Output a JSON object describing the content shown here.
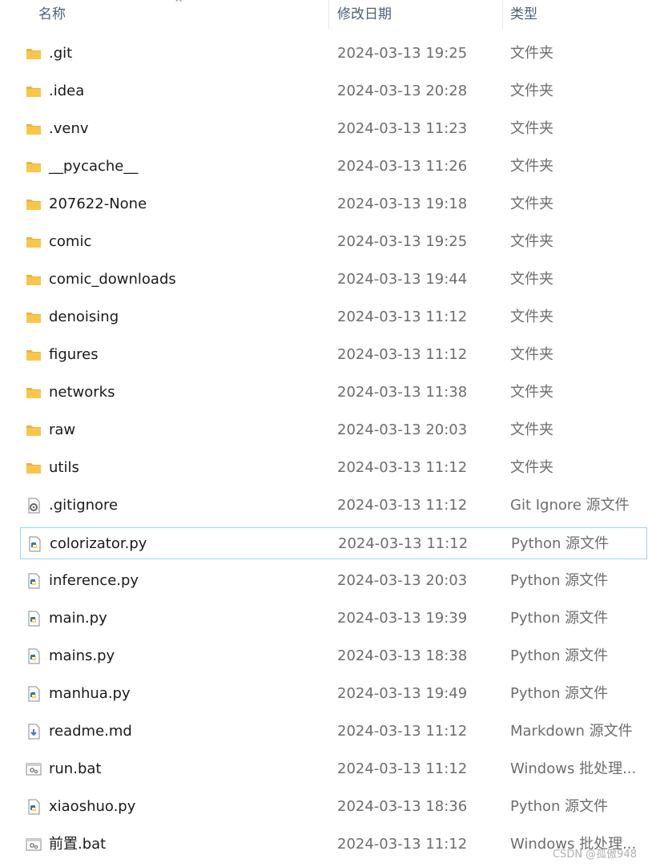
{
  "columns": {
    "name": "名称",
    "date": "修改日期",
    "type": "类型"
  },
  "files": [
    {
      "name": ".git",
      "date": "2024-03-13 19:25",
      "type": "文件夹",
      "icon": "folder-icon"
    },
    {
      "name": ".idea",
      "date": "2024-03-13 20:28",
      "type": "文件夹",
      "icon": "folder-icon"
    },
    {
      "name": ".venv",
      "date": "2024-03-13 11:23",
      "type": "文件夹",
      "icon": "folder-icon"
    },
    {
      "name": "__pycache__",
      "date": "2024-03-13 11:26",
      "type": "文件夹",
      "icon": "folder-icon"
    },
    {
      "name": "207622-None",
      "date": "2024-03-13 19:18",
      "type": "文件夹",
      "icon": "folder-icon"
    },
    {
      "name": "comic",
      "date": "2024-03-13 19:25",
      "type": "文件夹",
      "icon": "folder-icon"
    },
    {
      "name": "comic_downloads",
      "date": "2024-03-13 19:44",
      "type": "文件夹",
      "icon": "folder-icon"
    },
    {
      "name": "denoising",
      "date": "2024-03-13 11:12",
      "type": "文件夹",
      "icon": "folder-icon"
    },
    {
      "name": "figures",
      "date": "2024-03-13 11:12",
      "type": "文件夹",
      "icon": "folder-icon"
    },
    {
      "name": "networks",
      "date": "2024-03-13 11:38",
      "type": "文件夹",
      "icon": "folder-icon"
    },
    {
      "name": "raw",
      "date": "2024-03-13 20:03",
      "type": "文件夹",
      "icon": "folder-icon"
    },
    {
      "name": "utils",
      "date": "2024-03-13 11:12",
      "type": "文件夹",
      "icon": "folder-icon"
    },
    {
      "name": ".gitignore",
      "date": "2024-03-13 11:12",
      "type": "Git Ignore 源文件",
      "icon": "gear-file-icon"
    },
    {
      "name": "colorizator.py",
      "date": "2024-03-13 11:12",
      "type": "Python 源文件",
      "icon": "python-file-icon",
      "selected": true
    },
    {
      "name": "inference.py",
      "date": "2024-03-13 20:03",
      "type": "Python 源文件",
      "icon": "python-file-icon"
    },
    {
      "name": "main.py",
      "date": "2024-03-13 19:39",
      "type": "Python 源文件",
      "icon": "python-file-icon"
    },
    {
      "name": "mains.py",
      "date": "2024-03-13 18:38",
      "type": "Python 源文件",
      "icon": "python-file-icon"
    },
    {
      "name": "manhua.py",
      "date": "2024-03-13 19:49",
      "type": "Python 源文件",
      "icon": "python-file-icon"
    },
    {
      "name": "readme.md",
      "date": "2024-03-13 11:12",
      "type": "Markdown 源文件",
      "icon": "markdown-file-icon"
    },
    {
      "name": "run.bat",
      "date": "2024-03-13 11:12",
      "type": "Windows 批处理...",
      "icon": "batch-file-icon"
    },
    {
      "name": "xiaoshuo.py",
      "date": "2024-03-13 18:36",
      "type": "Python 源文件",
      "icon": "python-file-icon"
    },
    {
      "name": "前置.bat",
      "date": "2024-03-13 11:12",
      "type": "Windows 批处理...",
      "icon": "batch-file-icon"
    }
  ],
  "watermark": "CSDN @孤傲948",
  "colors": {
    "folder": "#f8c74a",
    "selection_border": "#99d9ea",
    "python_blue": "#3776ab",
    "python_yellow": "#ffd43b"
  }
}
